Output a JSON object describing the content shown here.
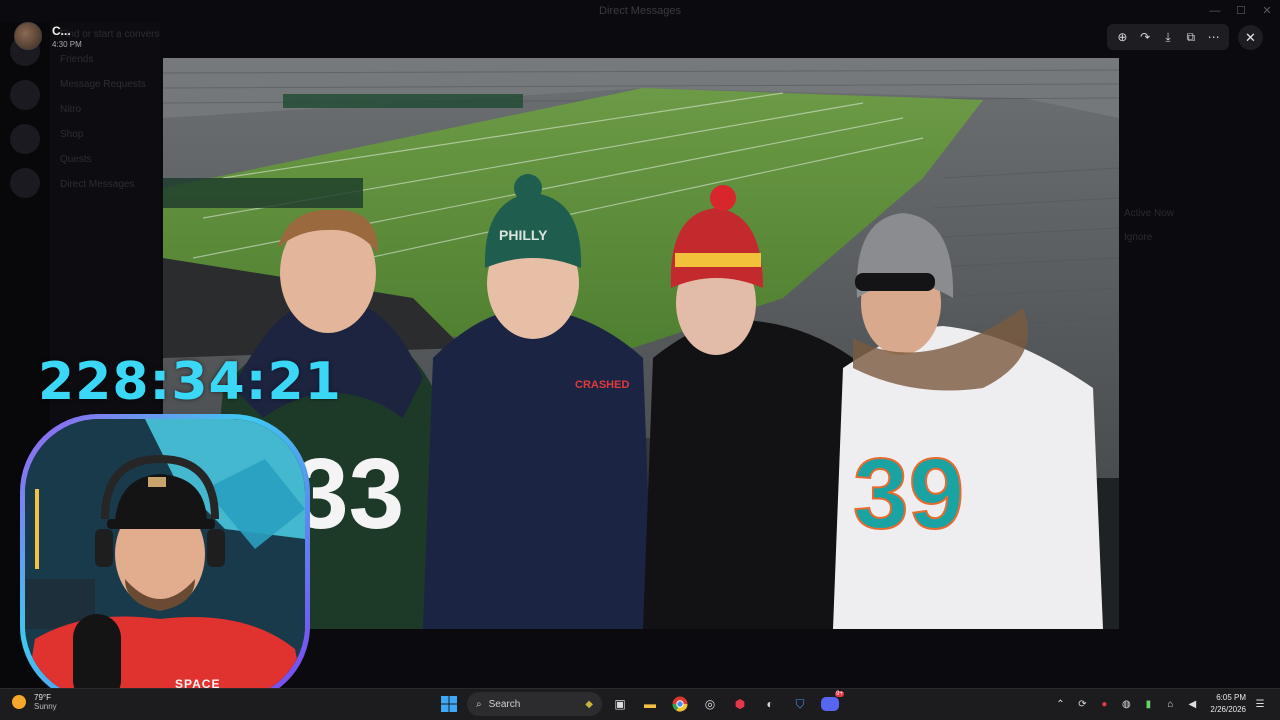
{
  "background_app": {
    "window_title": "Direct Messages",
    "sidebar_items": [
      "Find or start a conversation",
      "Friends",
      "Message Requests",
      "Nitro",
      "Shop",
      "Quests",
      "Direct Messages"
    ],
    "right_text": [
      "Active Now",
      "Ignore"
    ]
  },
  "viewer": {
    "user_name": "C...",
    "timestamp": "4:30 PM",
    "toolbar": [
      {
        "icon": "zoom-in-icon",
        "glyph": "⊕"
      },
      {
        "icon": "forward-icon",
        "glyph": "↷"
      },
      {
        "icon": "download-icon",
        "glyph": "⤓"
      },
      {
        "icon": "open-external-icon",
        "glyph": "⧉"
      },
      {
        "icon": "more-icon",
        "glyph": "⋯"
      }
    ],
    "close_glyph": "✕"
  },
  "photo": {
    "jersey_left": "33",
    "jersey_right": "39",
    "beanie_left_text": "PHILLY",
    "patch_text": "CRASHED"
  },
  "stream_overlay": {
    "timer": "228:34:21",
    "webcam_label": "SPACE"
  },
  "taskbar": {
    "weather_temp": "79°F",
    "weather_condition": "Sunny",
    "search_placeholder": "Search",
    "time": "6:05 PM",
    "date": "2/26/2026",
    "notification_badge": "9+"
  },
  "colors": {
    "timer": "#3ad8f6",
    "webcam_border": "#9a5cf0",
    "taskbar": "#1c1c1e"
  }
}
